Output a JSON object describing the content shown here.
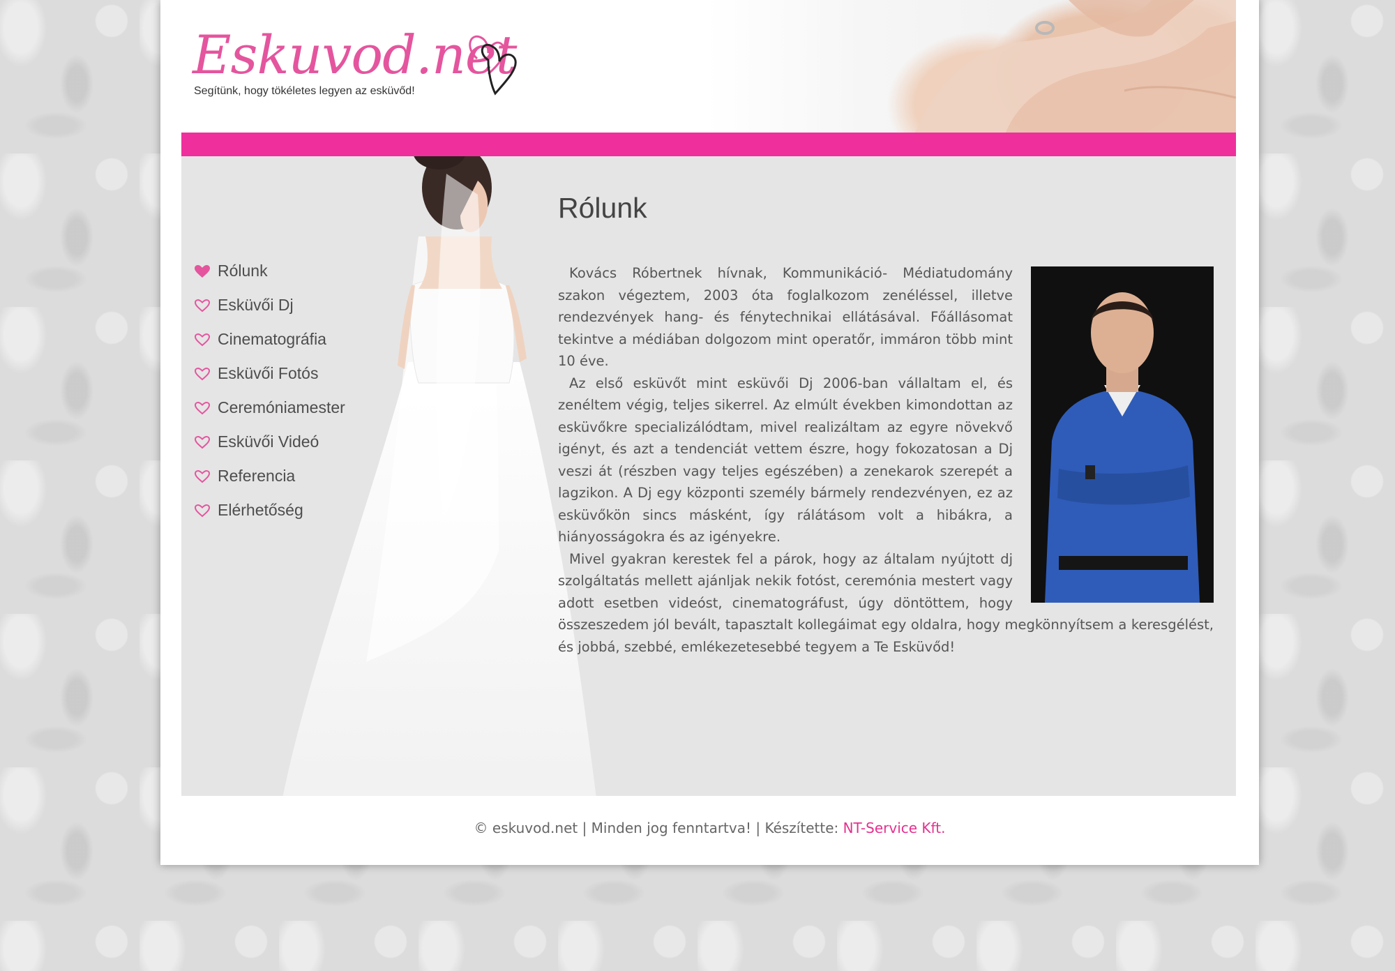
{
  "header": {
    "logo_text": "Eskuvod.net",
    "slogan": "Segítünk, hogy tökéletes legyen az esküvőd!"
  },
  "colors": {
    "accent": "#ef2f9c",
    "link": "#e4318f",
    "content_bg": "#e5e5e5"
  },
  "sidebar": {
    "items": [
      {
        "label": "Rólunk",
        "icon": "heart-filled-icon",
        "active": true
      },
      {
        "label": "Esküvői Dj",
        "icon": "heart-outline-icon"
      },
      {
        "label": "Cinematográfia",
        "icon": "heart-outline-icon"
      },
      {
        "label": "Esküvői Fotós",
        "icon": "heart-outline-icon"
      },
      {
        "label": "Ceremóniamester",
        "icon": "heart-outline-icon"
      },
      {
        "label": "Esküvői Videó",
        "icon": "heart-outline-icon"
      },
      {
        "label": "Referencia",
        "icon": "heart-outline-icon"
      },
      {
        "label": "Elérhetőség",
        "icon": "heart-outline-icon"
      }
    ]
  },
  "main": {
    "title": "Rólunk",
    "paragraphs": [
      "Kovács Róbertnek hívnak, Kommunikáció- Médiatudomány szakon végeztem, 2003 óta foglalkozom zenéléssel, illetve rendezvények hang- és fénytechnikai ellátásával. Főállásomat tekintve a médiában dolgozom mint operatőr, immáron több mint 10 éve.",
      "Az első esküvőt mint esküvői Dj 2006-ban vállaltam el, és zenéltem végig, teljes sikerrel. Az elmúlt években kimondottan az esküvőkre specializálódtam, mivel realizáltam az egyre növekvő igényt, és azt a tendenciát vettem észre, hogy fokozatosan a Dj veszi át (részben vagy teljes egészében) a zenekarok szerepét a lagzikon. A Dj egy központi személy bármely rendezvényen, ez az esküvőkön sincs másként, így rálátásom volt a hibákra, a hiányosságokra és az igényekre.",
      "Mivel gyakran kerestek fel a párok, hogy az általam nyújtott dj szolgáltatás mellett ajánljak nekik fotóst, ceremónia mestert vagy adott esetben videóst, cinematográfust, úgy döntöttem, hogy összeszedem jól bevált, tapasztalt kollegáimat egy oldalra, hogy megkönnyítsem a keresgélést, és jobbá, szebbé, emlékezetesebbé tegyem a Te Esküvőd!"
    ]
  },
  "footer": {
    "text": "© eskuvod.net | Minden jog fenntartva! | Készítette: ",
    "link_label": "NT-Service Kft."
  }
}
